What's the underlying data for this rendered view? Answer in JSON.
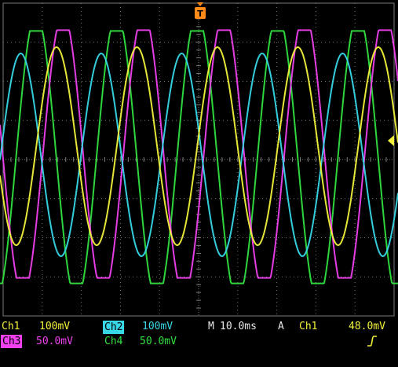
{
  "trigger_marker": {
    "label": "T"
  },
  "channels": [
    {
      "name": "Ch1",
      "scale": "100mV",
      "color": "#f2f23c"
    },
    {
      "name": "Ch2",
      "scale": "100mV",
      "color": "#38d8e8"
    },
    {
      "name": "Ch3",
      "scale": "50.0mV",
      "color": "#f040f0"
    },
    {
      "name": "Ch4",
      "scale": "50.0mV",
      "color": "#30e040"
    }
  ],
  "timebase": {
    "prefix": "M",
    "value": "10.0ms"
  },
  "trigger": {
    "mode": "A",
    "source": "Ch1",
    "slope_icon": "rising-edge-icon",
    "level": "48.0mV"
  },
  "colors": {
    "grid": "#7a7a7a",
    "trigger_marker": "#ff8a1a",
    "badge_text": "#000000"
  }
}
